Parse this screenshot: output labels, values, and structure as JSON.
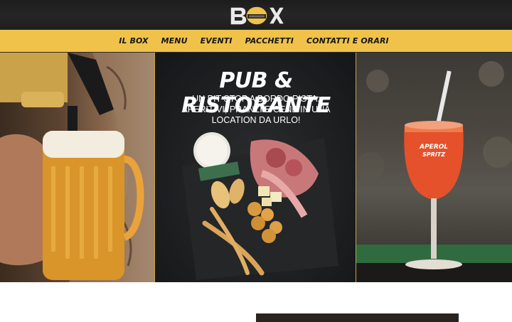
{
  "header": {
    "logo_text": "BOX"
  },
  "nav": {
    "items": [
      {
        "label": "IL BOX"
      },
      {
        "label": "MENU"
      },
      {
        "label": "EVENTI"
      },
      {
        "label": "PACCHETTI"
      },
      {
        "label": "CONTATTI E ORARI"
      }
    ]
  },
  "hero": {
    "title": "PUB & RISTORANTE",
    "subtitle": "UN PIT STOP A BORDO PISTA: APERITIVI, PRANZI E CENE IN UNA LOCATION DA URLO!",
    "glass_text_1": "APEROL",
    "glass_text_2": "SPRITZ"
  },
  "colors": {
    "nav_bg": "#f0c24a",
    "header_bg": "#1e1e1e",
    "accent": "#c9a23c"
  }
}
